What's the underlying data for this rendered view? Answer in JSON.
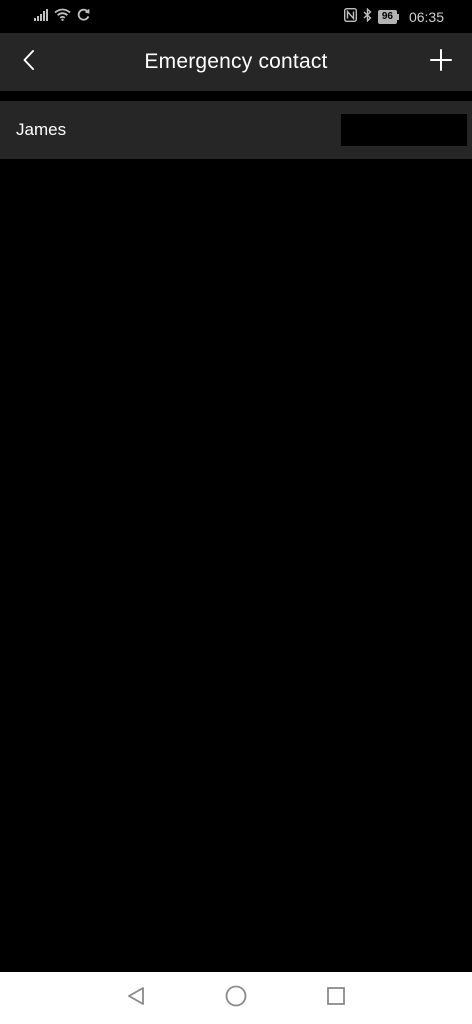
{
  "status_bar": {
    "time": "06:35",
    "battery_level": "96",
    "icons": [
      "signal-icon",
      "wifi-icon",
      "sync-icon",
      "nfc-icon",
      "bluetooth-icon",
      "battery-icon"
    ]
  },
  "header": {
    "title": "Emergency contact",
    "back_icon": "chevron-left-icon",
    "add_icon": "plus-icon"
  },
  "contacts": [
    {
      "name": "James"
    }
  ],
  "nav_bar": {
    "icons": [
      "triangle-back-icon",
      "circle-home-icon",
      "square-recents-icon"
    ]
  },
  "colors": {
    "background": "#000000",
    "surface": "#262626",
    "text_primary": "#ffffff",
    "nav_background": "#ffffff",
    "nav_icon": "#8a8a8a"
  }
}
